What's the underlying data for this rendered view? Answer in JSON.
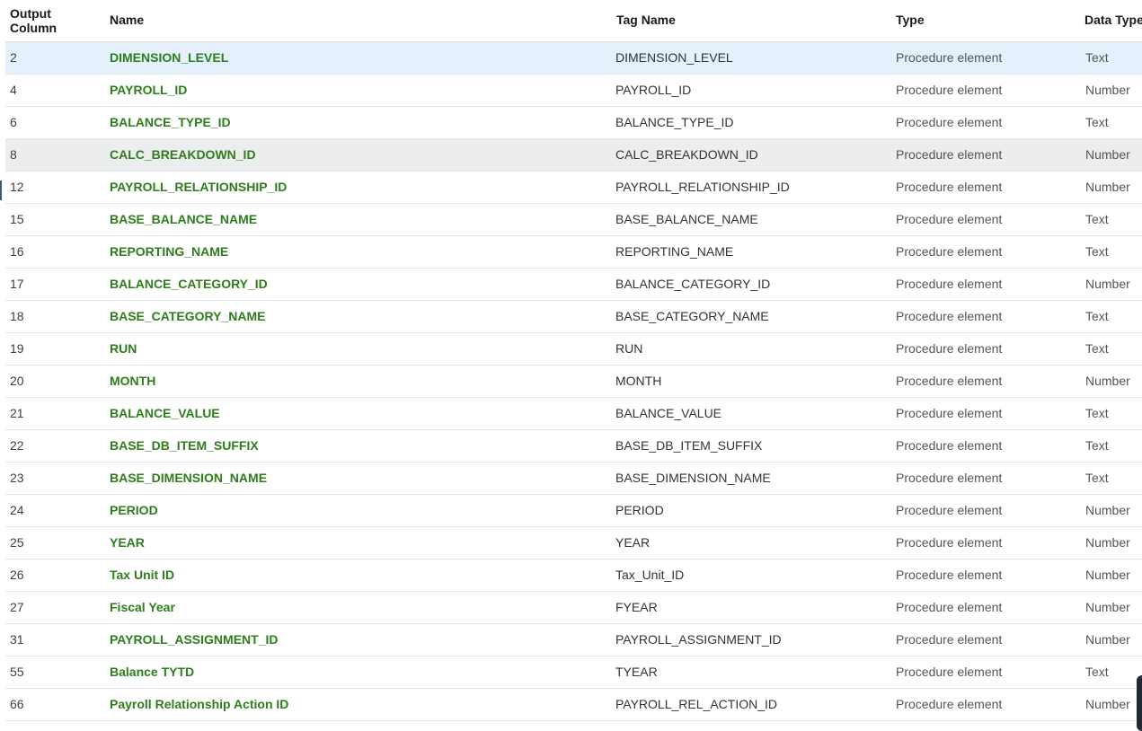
{
  "columns": {
    "output_column": "Output Column",
    "name": "Name",
    "tag_name": "Tag Name",
    "type": "Type",
    "data_type": "Data Type"
  },
  "rows": [
    {
      "col": "2",
      "name": "DIMENSION_LEVEL",
      "tag": "DIMENSION_LEVEL",
      "type": "Procedure element",
      "dtype": "Text"
    },
    {
      "col": "4",
      "name": "PAYROLL_ID",
      "tag": "PAYROLL_ID",
      "type": "Procedure element",
      "dtype": "Number"
    },
    {
      "col": "6",
      "name": "BALANCE_TYPE_ID",
      "tag": "BALANCE_TYPE_ID",
      "type": "Procedure element",
      "dtype": "Text"
    },
    {
      "col": "8",
      "name": "CALC_BREAKDOWN_ID",
      "tag": "CALC_BREAKDOWN_ID",
      "type": "Procedure element",
      "dtype": "Number"
    },
    {
      "col": "12",
      "name": "PAYROLL_RELATIONSHIP_ID",
      "tag": "PAYROLL_RELATIONSHIP_ID",
      "type": "Procedure element",
      "dtype": "Number"
    },
    {
      "col": "15",
      "name": "BASE_BALANCE_NAME",
      "tag": "BASE_BALANCE_NAME",
      "type": "Procedure element",
      "dtype": "Text"
    },
    {
      "col": "16",
      "name": "REPORTING_NAME",
      "tag": "REPORTING_NAME",
      "type": "Procedure element",
      "dtype": "Text"
    },
    {
      "col": "17",
      "name": "BALANCE_CATEGORY_ID",
      "tag": "BALANCE_CATEGORY_ID",
      "type": "Procedure element",
      "dtype": "Number"
    },
    {
      "col": "18",
      "name": "BASE_CATEGORY_NAME",
      "tag": "BASE_CATEGORY_NAME",
      "type": "Procedure element",
      "dtype": "Text"
    },
    {
      "col": "19",
      "name": "RUN",
      "tag": "RUN",
      "type": "Procedure element",
      "dtype": "Text"
    },
    {
      "col": "20",
      "name": "MONTH",
      "tag": "MONTH",
      "type": "Procedure element",
      "dtype": "Number"
    },
    {
      "col": "21",
      "name": "BALANCE_VALUE",
      "tag": "BALANCE_VALUE",
      "type": "Procedure element",
      "dtype": "Text"
    },
    {
      "col": "22",
      "name": "BASE_DB_ITEM_SUFFIX",
      "tag": "BASE_DB_ITEM_SUFFIX",
      "type": "Procedure element",
      "dtype": "Text"
    },
    {
      "col": "23",
      "name": "BASE_DIMENSION_NAME",
      "tag": "BASE_DIMENSION_NAME",
      "type": "Procedure element",
      "dtype": "Text"
    },
    {
      "col": "24",
      "name": "PERIOD",
      "tag": "PERIOD",
      "type": "Procedure element",
      "dtype": "Number"
    },
    {
      "col": "25",
      "name": "YEAR",
      "tag": "YEAR",
      "type": "Procedure element",
      "dtype": "Number"
    },
    {
      "col": "26",
      "name": "Tax Unit ID",
      "tag": "Tax_Unit_ID",
      "type": "Procedure element",
      "dtype": "Number"
    },
    {
      "col": "27",
      "name": "Fiscal Year",
      "tag": "FYEAR",
      "type": "Procedure element",
      "dtype": "Number"
    },
    {
      "col": "31",
      "name": "PAYROLL_ASSIGNMENT_ID",
      "tag": "PAYROLL_ASSIGNMENT_ID",
      "type": "Procedure element",
      "dtype": "Number"
    },
    {
      "col": "55",
      "name": "Balance TYTD",
      "tag": "TYEAR",
      "type": "Procedure element",
      "dtype": "Text"
    },
    {
      "col": "66",
      "name": "Payroll Relationship Action ID",
      "tag": "PAYROLL_REL_ACTION_ID",
      "type": "Procedure element",
      "dtype": "Number"
    }
  ],
  "selected_row": 0,
  "hovered_row": 3,
  "colors": {
    "name_link": "#2e7d1b",
    "selected_row_bg": "#e4f1fc",
    "hover_row_bg": "#ebedef"
  }
}
